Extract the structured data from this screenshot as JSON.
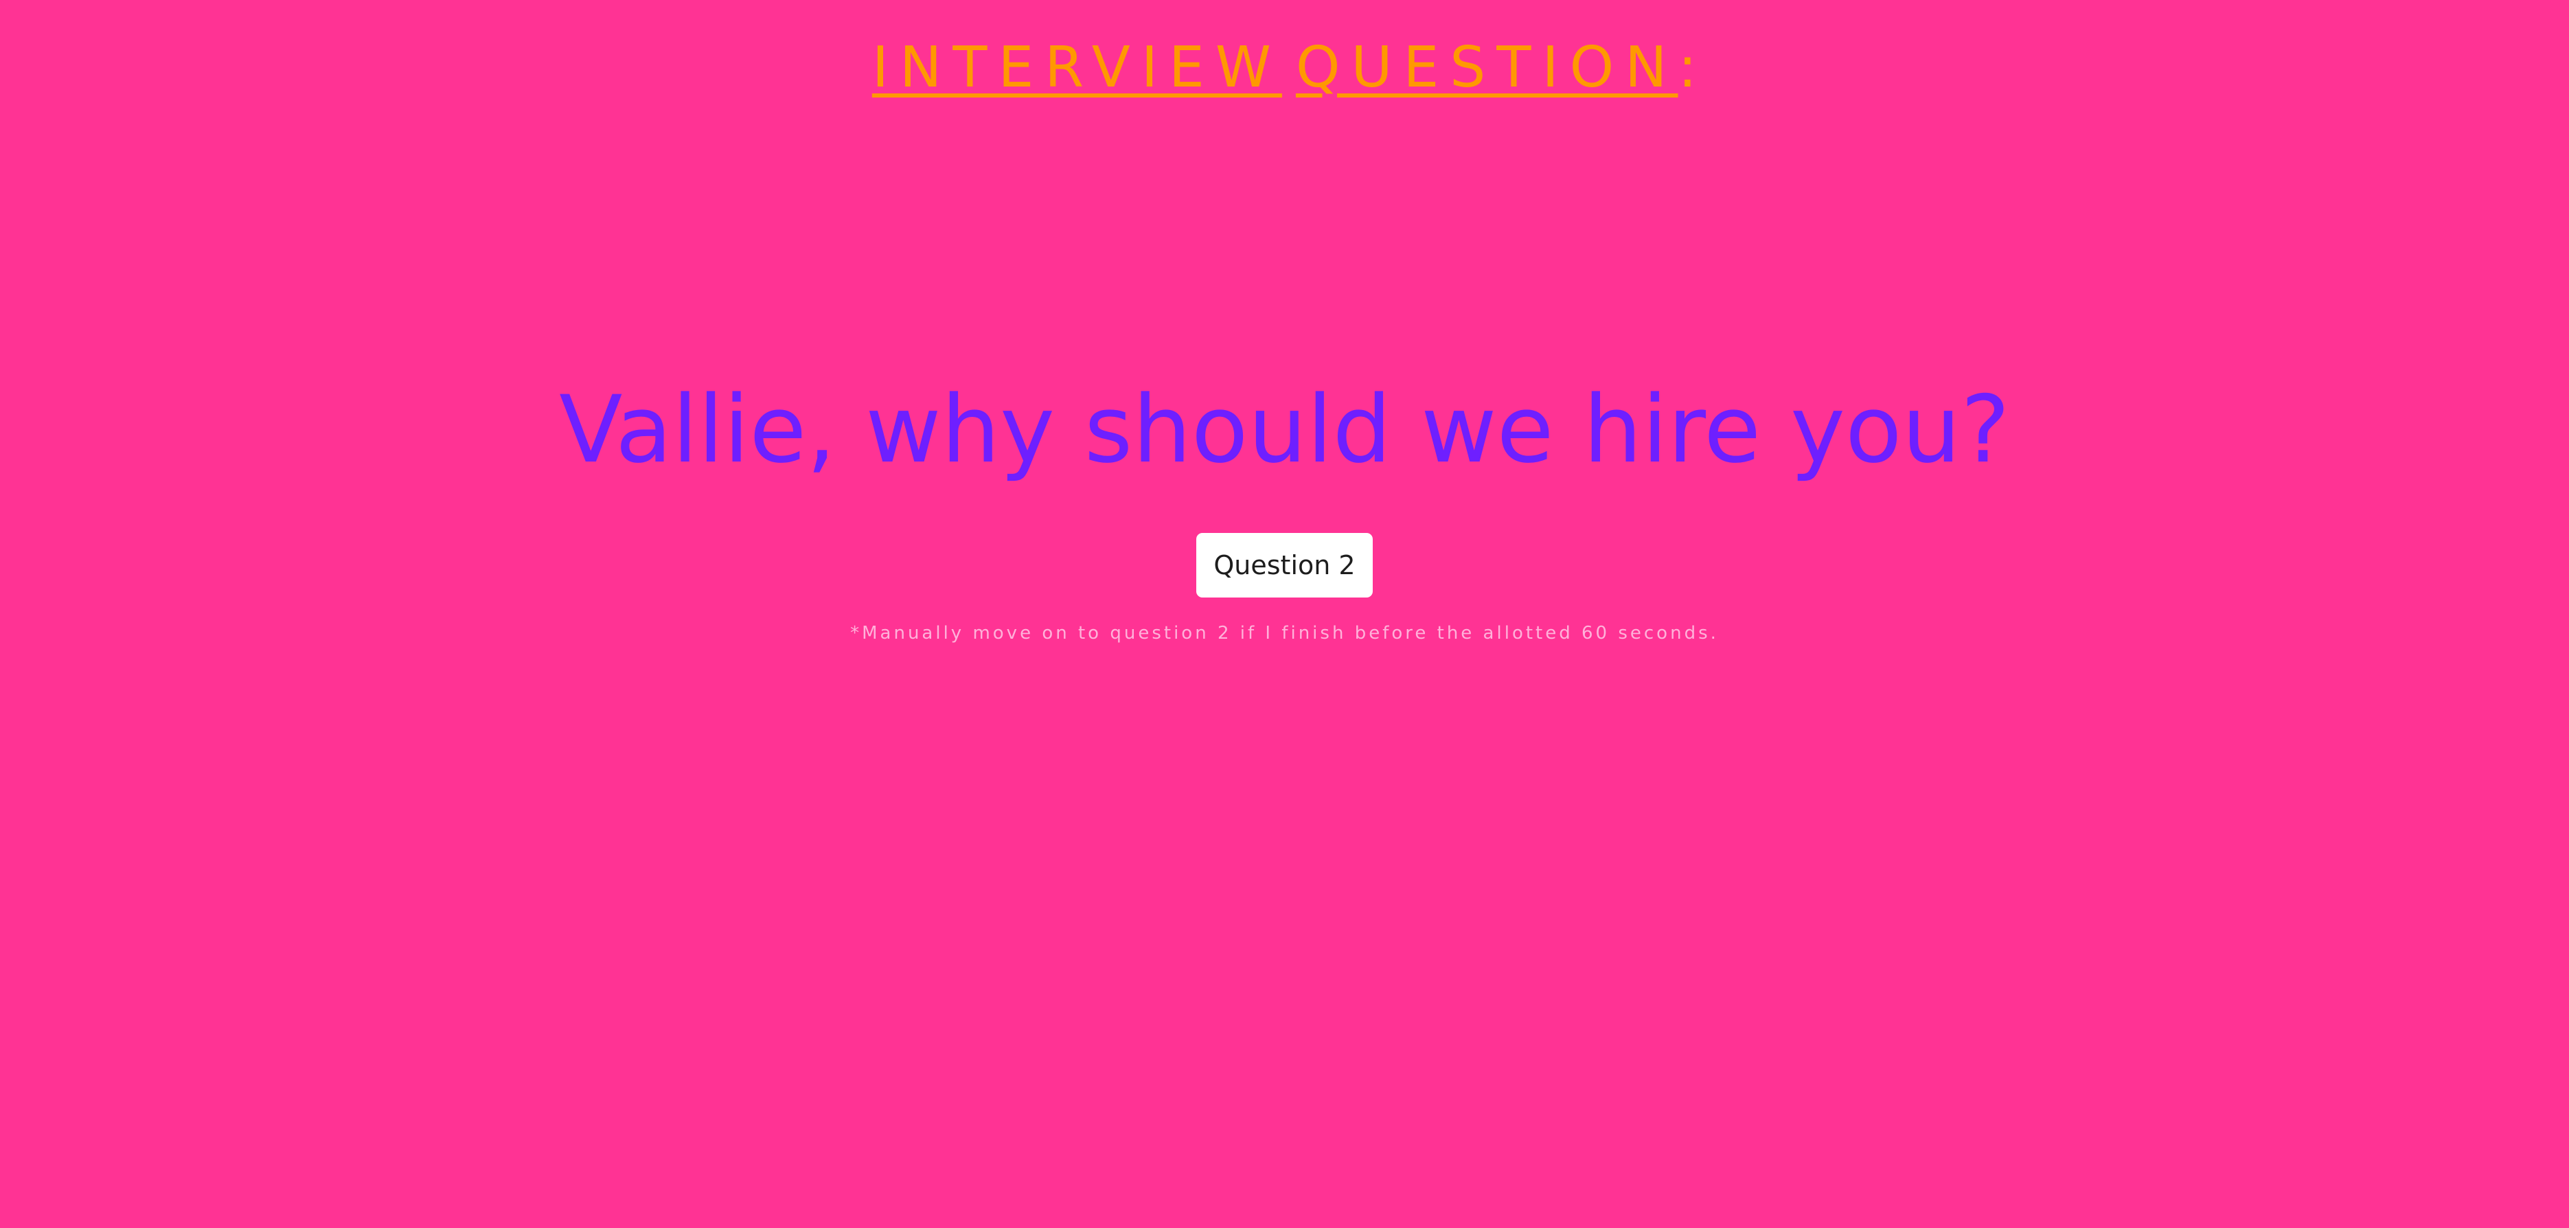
{
  "header": {
    "word_1": "INTERVIEW",
    "word_2": "QUESTION",
    "colon": ":"
  },
  "question": {
    "text": "Vallie, why should we hire you?"
  },
  "navigation": {
    "next_button_label": "Question 2",
    "note": "*Manually move on to question 2 if I finish before the allotted 60 seconds."
  },
  "colors": {
    "background": "#ff3394",
    "heading": "#ff9900",
    "question": "#6e1fff",
    "button_background": "#ffffff",
    "note": "#ffb2da"
  }
}
